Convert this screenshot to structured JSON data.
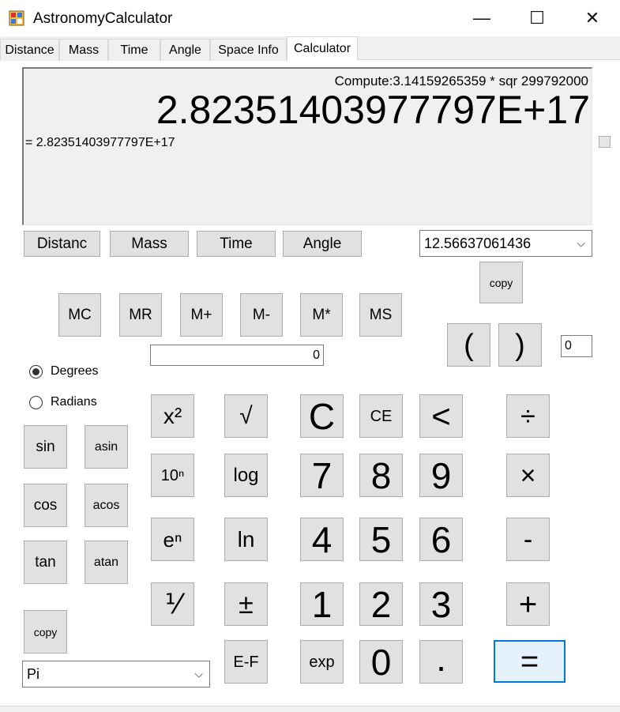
{
  "window": {
    "title": "AstronomyCalculator",
    "minimize_glyph": "—",
    "maximize_glyph": "☐",
    "close_glyph": "✕"
  },
  "tabs": [
    "Distance",
    "Mass",
    "Time",
    "Angle",
    "Space Info",
    "Calculator"
  ],
  "active_tab": "Calculator",
  "display": {
    "expression": "Compute:3.14159265359 * sqr 299792000",
    "value": "2.82351403977797E+17",
    "result_line": "= 2.82351403977797E+17"
  },
  "unit_buttons": [
    "Distanc",
    "Mass",
    "Time",
    "Angle"
  ],
  "constant_combo": {
    "value": "12.56637061436"
  },
  "copy_top": "copy",
  "memory_buttons": [
    "MC",
    "MR",
    "M+",
    "M-",
    "M*",
    "MS"
  ],
  "memory_value": "0",
  "paren_open": "(",
  "paren_close": ")",
  "paren_count": "0",
  "angle_mode": {
    "degrees": "Degrees",
    "radians": "Radians",
    "selected": "Degrees"
  },
  "trig": [
    "sin",
    "asin",
    "cos",
    "acos",
    "tan",
    "atan"
  ],
  "copy_bottom": "copy",
  "bottom_combo": {
    "value": "Pi"
  },
  "functions": {
    "square": "x²",
    "sqrt": "√",
    "pow10": "10ⁿ",
    "log": "log",
    "exp_e": "eⁿ",
    "ln": "ln",
    "reciprocal": "⅟",
    "negate": "±",
    "ef": "E-F",
    "exp": "exp"
  },
  "clear": {
    "c": "C",
    "ce": "CE",
    "back": "<"
  },
  "digits": [
    "7",
    "8",
    "9",
    "4",
    "5",
    "6",
    "1",
    "2",
    "3",
    "0",
    "."
  ],
  "operators": {
    "divide": "÷",
    "multiply": "×",
    "minus": "-",
    "plus": "+",
    "equals": "="
  }
}
